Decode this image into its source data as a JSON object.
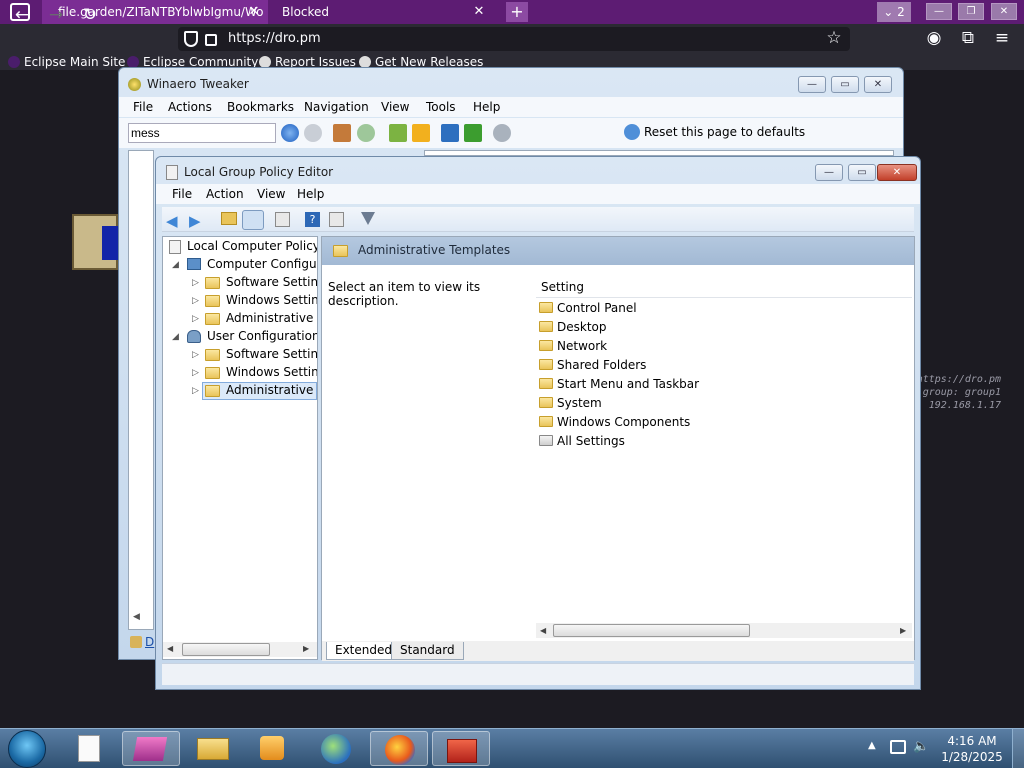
{
  "browser": {
    "tabs": [
      {
        "title": "file.garden/ZITaNTBYblwbIgmu/Wo"
      },
      {
        "title": "Blocked"
      }
    ],
    "tab_count": "2",
    "url": "https://dro.pm",
    "bookmarks": [
      "Eclipse Main Site",
      "Eclipse Community",
      "Report Issues",
      "Get New Releases"
    ]
  },
  "desktop": {
    "overlay_lines": [
      "https://dro.pm",
      "group: group1",
      "192.168.1.17"
    ]
  },
  "winaero": {
    "title": "Winaero Tweaker",
    "menu": [
      "File",
      "Actions",
      "Bookmarks",
      "Navigation",
      "View",
      "Tools",
      "Help"
    ],
    "search_value": "mess",
    "reset_label": "Reset this page to defaults",
    "partial_link": "D"
  },
  "gpedit": {
    "title": "Local Group Policy Editor",
    "menu": [
      "File",
      "Action",
      "View",
      "Help"
    ],
    "tree": [
      {
        "label": "Local Computer Policy"
      },
      {
        "label": "Computer Configura"
      },
      {
        "label": "Software Settings"
      },
      {
        "label": "Windows Setting"
      },
      {
        "label": "Administrative Te"
      },
      {
        "label": "User Configuration"
      },
      {
        "label": "Software Settings"
      },
      {
        "label": "Windows Setting"
      },
      {
        "label": "Administrative Te"
      }
    ],
    "header_title": "Administrative Templates",
    "description": "Select an item to view its description.",
    "column_header": "Setting",
    "items": [
      "Control Panel",
      "Desktop",
      "Network",
      "Shared Folders",
      "Start Menu and Taskbar",
      "System",
      "Windows Components",
      "All Settings"
    ],
    "view_tabs": [
      "Extended",
      "Standard"
    ]
  },
  "taskbar": {
    "time": "4:16 AM",
    "date": "1/28/2025"
  },
  "colors": {
    "tabbar": "#5d1c73",
    "taskbar": "#3d6489",
    "window_frame": "#c4d7ec"
  }
}
